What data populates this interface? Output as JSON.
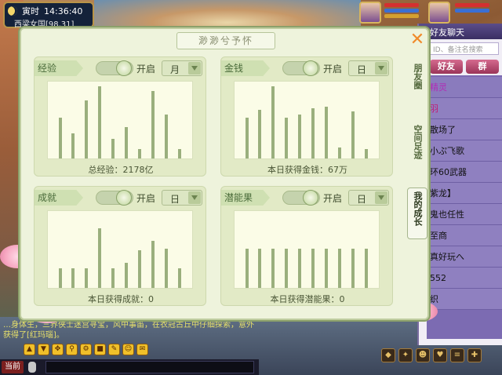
{
  "hud": {
    "time": "14:36:40",
    "time_label": "寅时",
    "location": "西梁女国[98,31]"
  },
  "chat_panel": {
    "title": "好友聊天",
    "search_placeholder": "ID、备注名搜索",
    "tabs": [
      "好友",
      "群"
    ],
    "items": [
      "精灵",
      "羽",
      "散场了",
      "小ぷ飞歌",
      "环60武器",
      "紫龙】",
      "鬼也任性",
      "至商",
      "真好玩へ",
      "552",
      "织"
    ]
  },
  "system_message": "…身体生，三界侠士迷宫寻宝，风中事笛，在衣冠古丘中仔细探索，意外获得了[红玛瑙]。",
  "input_bar": {
    "channel": "当前"
  },
  "dialog": {
    "title": "渺渺兮予怀",
    "close_icon": "close-icon",
    "side_tabs": [
      "朋友圈",
      "空间足迹",
      "我的成长"
    ],
    "cards": [
      {
        "label": "经验",
        "toggle_text": "开启",
        "period": "月",
        "footer": "总经验：2178亿"
      },
      {
        "label": "金钱",
        "toggle_text": "开启",
        "period": "日",
        "footer": "本日获得金钱：67万"
      },
      {
        "label": "成就",
        "toggle_text": "开启",
        "period": "日",
        "footer": "本日获得成就：0"
      },
      {
        "label": "潜能果",
        "toggle_text": "开启",
        "period": "日",
        "footer": "本日获得潜能果：0"
      }
    ]
  },
  "chart_data": [
    {
      "type": "bar",
      "title": "经验",
      "values": [
        52,
        32,
        74,
        92,
        25,
        40,
        12,
        86,
        56,
        12
      ]
    },
    {
      "type": "bar",
      "title": "金钱",
      "values": [
        52,
        62,
        92,
        52,
        56,
        64,
        66,
        14,
        60,
        12
      ]
    },
    {
      "type": "bar",
      "title": "成就",
      "values": [
        25,
        25,
        25,
        76,
        25,
        32,
        48,
        60,
        50,
        25
      ]
    },
    {
      "type": "bar",
      "title": "潜能果",
      "values": [
        50,
        50,
        50,
        50,
        50,
        50,
        50,
        50,
        50,
        50
      ]
    }
  ],
  "colors": {
    "accent": "#f08a2a",
    "panel": "#eef3dc",
    "bar": "#9aaf7d"
  }
}
